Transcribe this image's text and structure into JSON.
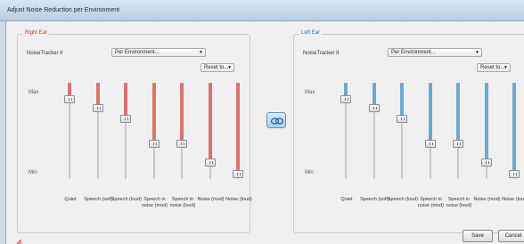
{
  "window": {
    "title": "Adjust Noise Reduction per Environment"
  },
  "right_ear": {
    "legend": "Right Ear",
    "noise_tracker_label": "NoiseTracker II",
    "mode": "Per Environment...",
    "reset": "Reset to...",
    "level_max": "Max",
    "level_min": "Min",
    "sliders": [
      {
        "label": "Quiet",
        "level": 0.0
      },
      {
        "label": "Speech (soft)",
        "level": 0.1
      },
      {
        "label": "Speech (loud)",
        "level": 0.22
      },
      {
        "label": "Speech in noise (mod)",
        "level": 0.5
      },
      {
        "label": "Speech in noise (loud)",
        "level": 0.5
      },
      {
        "label": "Noise (mod)",
        "level": 0.72
      },
      {
        "label": "Noise (loud)",
        "level": 0.85
      }
    ]
  },
  "left_ear": {
    "legend": "Left Ear",
    "noise_tracker_label": "NoiseTracker II",
    "mode": "Per Environment...",
    "reset": "Reset to...",
    "level_max": "Max",
    "level_min": "Min",
    "sliders": [
      {
        "label": "Quiet",
        "level": 0.0
      },
      {
        "label": "Speech (soft)",
        "level": 0.1
      },
      {
        "label": "Speech (loud)",
        "level": 0.22
      },
      {
        "label": "Speech in noise (mod)",
        "level": 0.5
      },
      {
        "label": "Speech in noise (loud)",
        "level": 0.5
      },
      {
        "label": "Noise (mod)",
        "level": 0.72
      },
      {
        "label": "Noise (loud)",
        "level": 0.85
      }
    ]
  },
  "footer": {
    "save_label": "Save",
    "cancel_label": "Cancel"
  },
  "colors": {
    "right_accent": "#d9736c",
    "left_accent": "#6fa8cf",
    "sync_button": "#a8d0f0"
  },
  "icons": {
    "sync": "link-ears-icon",
    "resize": "resize-grip-icon"
  }
}
